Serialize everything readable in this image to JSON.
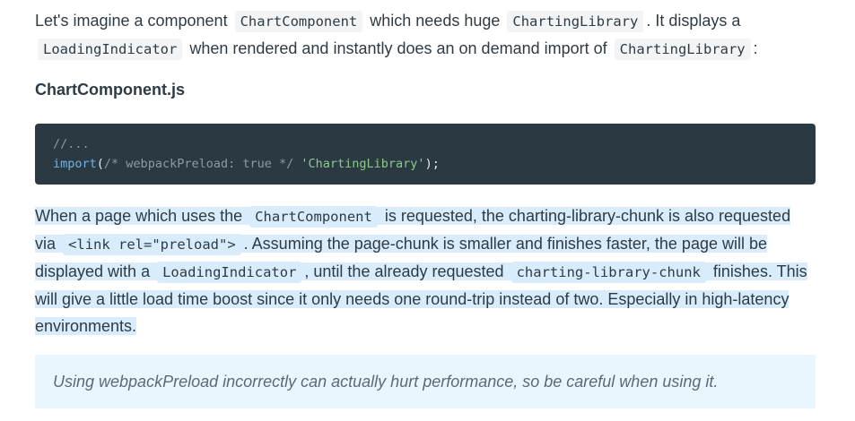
{
  "intro": {
    "t1": "Let's imagine a component",
    "c1": "ChartComponent",
    "t2": "which needs huge",
    "c2": "ChartingLibrary",
    "t3": ". It displays a",
    "c3": "LoadingIndicator",
    "t4": "when rendered and instantly does an on demand import of",
    "c4": "ChartingLibrary",
    "t5": ":"
  },
  "file_title": "ChartComponent.js",
  "code": {
    "line1": "//...",
    "kw": "import",
    "open": "(",
    "comment": "/* webpackPreload: true */",
    "space": " ",
    "string": "'ChartingLibrary'",
    "close": ");"
  },
  "detail": {
    "t1": "When a page which uses the",
    "c1": "ChartComponent",
    "t2": "is requested, the charting-library-chunk is also requested via",
    "c2": "<link rel=\"preload\">",
    "t3": ". Assuming the page-chunk is smaller and finishes faster, the page will be displayed with a",
    "c3": "LoadingIndicator",
    "t4": ", until the already requested",
    "c4": "charting-library-chunk",
    "t5": "finishes. This will give a little load time boost since it only needs one round-trip instead of two. Especially in high-latency environments."
  },
  "tip": "Using webpackPreload incorrectly can actually hurt performance, so be careful when using it."
}
